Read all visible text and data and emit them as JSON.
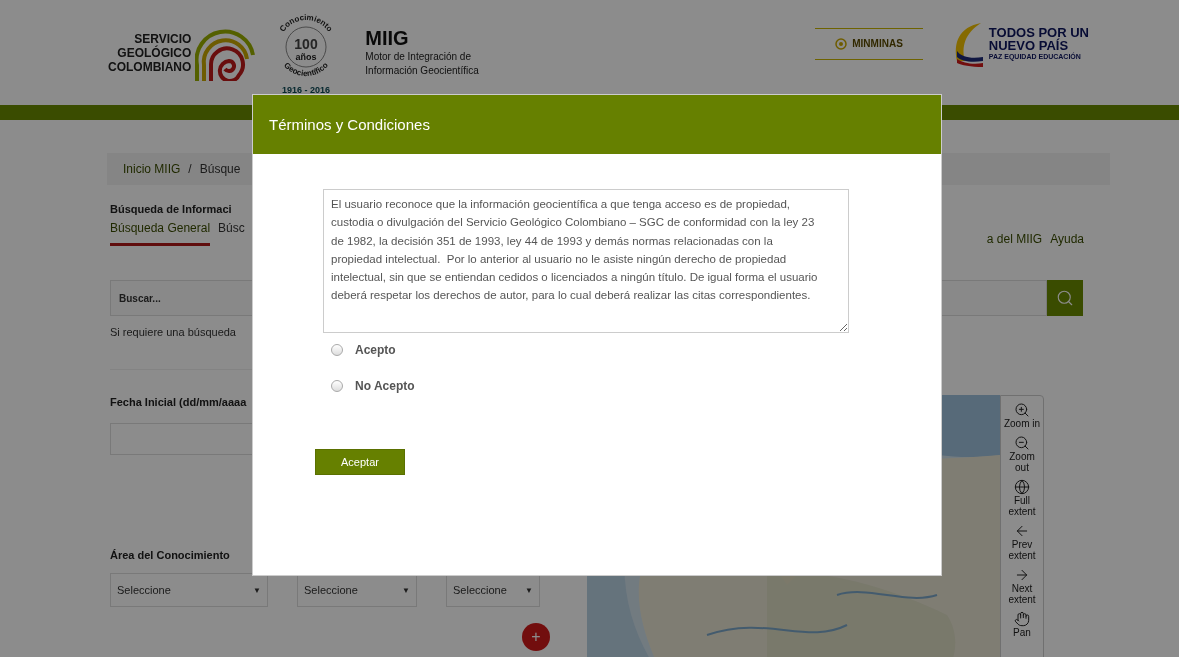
{
  "header": {
    "agency_logo": [
      "SERVICIO",
      "GEOLÓGICO",
      "COLOMBIANO"
    ],
    "centenary_badge": {
      "arc_top": "Conocimiento",
      "number": "100",
      "word": "años",
      "arc_bottom": "Geocientífico",
      "years": "1916 - 2016"
    },
    "app": {
      "name": "MIIG",
      "subtitle": [
        "Motor de Integración de",
        "Información Geocientífica"
      ]
    },
    "ministry_logo": "MINMINAS",
    "government_logo": {
      "lines": [
        "TODOS POR UN",
        "NUEVO PAÍS"
      ],
      "tagline": "PAZ  EQUIDAD  EDUCACIÓN"
    }
  },
  "breadcrumb": {
    "items": [
      "Inicio MIIG",
      "Búsque"
    ],
    "separator": "/"
  },
  "section_title": "Búsqueda de Informaci",
  "tabs": [
    {
      "label": "Búsqueda General",
      "selected": true
    },
    {
      "label": "Búsc",
      "selected": false
    }
  ],
  "links": [
    "a del MIIG",
    "Ayuda"
  ],
  "search": {
    "placeholder": "Buscar..."
  },
  "hint": "Si requiere una búsqueda",
  "date_field": {
    "label": "Fecha Inicial (dd/mm/aaaa"
  },
  "knowledge_area": {
    "label": "Área del Conocimiento",
    "selects": [
      "Seleccione",
      "Seleccione",
      "Seleccione"
    ],
    "caret": "▼"
  },
  "add_button": "+",
  "map": {
    "kind": "picture",
    "tools": [
      {
        "kind": "zoom_in",
        "label": "Zoom in"
      },
      {
        "kind": "zoom_out",
        "label": "Zoom out"
      },
      {
        "kind": "full_extent",
        "label": "Full extent"
      },
      {
        "kind": "prev",
        "label": "Prev extent"
      },
      {
        "kind": "next",
        "label": "Next extent"
      },
      {
        "kind": "pan",
        "label": "Pan"
      }
    ]
  },
  "modal": {
    "title": "Términos y Condiciones",
    "terms": "El usuario reconoce que la información geocientífica a que tenga acceso es de propiedad, custodia o divulgación del Servicio Geológico Colombiano – SGC de conformidad con la ley 23 de 1982, la decisión 351 de 1993, ley 44 de 1993 y demás normas relacionadas con la propiedad intelectual.  Por lo anterior al usuario no le asiste ningún derecho de propiedad intelectual, sin que se entiendan cedidos o licenciados a ningún título. De igual forma el usuario deberá respetar los derechos de autor, para lo cual deberá realizar las citas correspondientes.",
    "options": [
      {
        "label": "Acepto",
        "selected": false
      },
      {
        "label": "No Acepto",
        "selected": false
      }
    ],
    "button": "Aceptar"
  }
}
